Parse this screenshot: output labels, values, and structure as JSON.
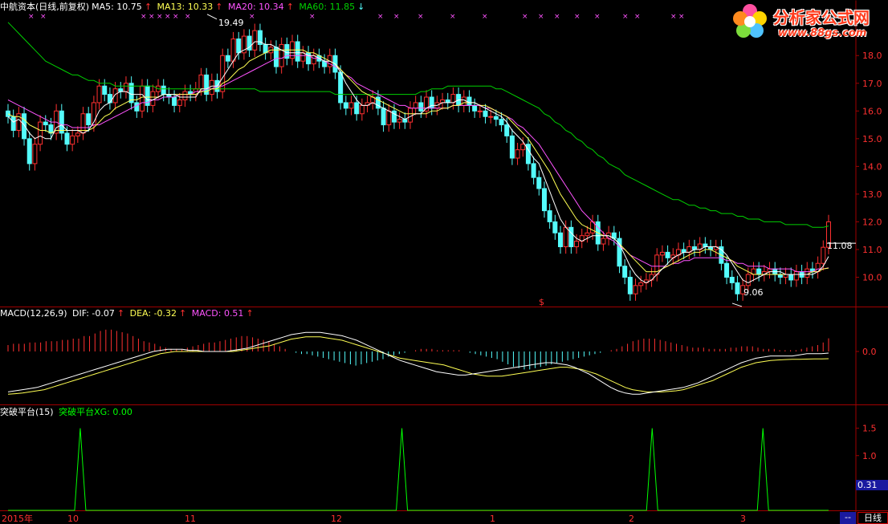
{
  "header": {
    "title": "中航资本(日线,前复权)",
    "ma5": "MA5: 10.75",
    "ma13": "MA13: 10.33",
    "ma20": "MA20: 10.34",
    "ma60": "MA60: 11.85",
    "up_arrow": "↑",
    "down_arrow": "↓"
  },
  "macd_header": {
    "title": "MACD(12,26,9)",
    "dif": "DIF: -0.07",
    "dea": "DEA: -0.32",
    "macd": "MACD: 0.51",
    "up_arrow": "↑"
  },
  "indicator_header": {
    "title": "突破平台(15)",
    "xg": "突破平台XG: 0.00"
  },
  "logo": {
    "name": "分析家公式网",
    "url": "www.88gs.com"
  },
  "annotations": {
    "high": "19.49",
    "low": "9.06",
    "last": "11.08",
    "signal_mark": "$"
  },
  "indicator_value": "0.31",
  "timeframe": "日线",
  "dash": "--",
  "x_axis_labels": [
    "2015年",
    "10",
    "11",
    "12",
    "1",
    "2",
    "3"
  ],
  "colors": {
    "up": "#ff3030",
    "down": "#54fcfc",
    "ma5": "#ffffff",
    "ma13": "#ffff54",
    "ma20": "#ff54ff",
    "ma60": "#00d000",
    "grid": "#a00000",
    "xg": "#00ff00"
  },
  "chart_data": [
    {
      "type": "candlestick",
      "title": "中航资本(日线,前复权)",
      "y_ticks": [
        10.0,
        11.0,
        12.0,
        13.0,
        14.0,
        15.0,
        16.0,
        17.0,
        18.0
      ],
      "ylim": [
        9.0,
        19.6
      ],
      "annotated_high": 19.49,
      "annotated_low": 9.06,
      "last_close": 11.08,
      "close": [
        15.8,
        15.3,
        15.9,
        15.0,
        14.1,
        14.8,
        15.6,
        15.5,
        15.2,
        16.0,
        15.2,
        14.8,
        15.1,
        15.2,
        15.9,
        15.5,
        16.3,
        16.9,
        16.6,
        16.3,
        16.8,
        16.7,
        17.0,
        16.3,
        16.0,
        16.9,
        16.2,
        16.7,
        16.9,
        16.6,
        16.5,
        16.2,
        16.4,
        16.7,
        16.6,
        16.8,
        17.3,
        16.6,
        17.1,
        16.7,
        18.0,
        17.8,
        18.6,
        18.1,
        18.7,
        18.2,
        18.9,
        18.4,
        18.1,
        18.3,
        17.6,
        18.4,
        17.9,
        18.5,
        17.8,
        18.1,
        17.7,
        18.0,
        17.8,
        17.6,
        18.0,
        17.4,
        16.3,
        16.1,
        16.3,
        15.9,
        16.2,
        16.3,
        16.5,
        16.1,
        15.5,
        16.0,
        15.6,
        15.7,
        15.6,
        16.1,
        16.3,
        16.0,
        16.5,
        16.1,
        16.3,
        16.4,
        16.3,
        16.6,
        16.2,
        16.5,
        16.2,
        16.0,
        16.0,
        15.8,
        15.8,
        15.7,
        15.5,
        15.1,
        14.3,
        14.6,
        14.8,
        14.1,
        13.6,
        13.2,
        12.4,
        12.0,
        11.6,
        11.1,
        11.8,
        11.1,
        11.3,
        11.5,
        11.6,
        12.0,
        11.2,
        11.4,
        11.6,
        11.4,
        10.4,
        10.0,
        9.4,
        9.7,
        9.8,
        9.9,
        10.1,
        10.8,
        10.9,
        10.7,
        10.8,
        11.0,
        10.9,
        11.1,
        11.0,
        11.2,
        11.1,
        11.0,
        11.1,
        10.5,
        10.0,
        9.8,
        9.4,
        9.7,
        10.1,
        10.3,
        10.1,
        10.2,
        10.3,
        10.1,
        10.0,
        10.1,
        9.9,
        10.2,
        10.0,
        10.3,
        10.2,
        10.5,
        11.08,
        12.0
      ],
      "ma5": [
        15.8,
        15.6,
        15.7,
        15.5,
        15.2,
        15.0,
        15.1,
        15.0,
        15.0,
        15.4,
        15.5,
        15.3,
        15.3,
        15.3,
        15.2,
        15.3,
        15.6,
        16.0,
        16.2,
        16.3,
        16.6,
        16.7,
        16.7,
        16.6,
        16.6,
        16.6,
        16.4,
        16.4,
        16.5,
        16.6,
        16.6,
        16.6,
        16.5,
        16.5,
        16.5,
        16.5,
        16.8,
        16.8,
        16.9,
        16.9,
        17.2,
        17.5,
        17.8,
        18.1,
        18.2,
        18.3,
        18.5,
        18.5,
        18.4,
        18.4,
        18.3,
        18.2,
        18.1,
        18.1,
        18.1,
        18.1,
        18.0,
        18.0,
        17.9,
        17.8,
        17.8,
        17.7,
        17.4,
        17.0,
        16.7,
        16.4,
        16.2,
        16.2,
        16.3,
        16.2,
        16.1,
        16.0,
        15.9,
        15.8,
        15.7,
        15.8,
        15.9,
        15.9,
        16.1,
        16.2,
        16.2,
        16.3,
        16.3,
        16.3,
        16.4,
        16.4,
        16.3,
        16.3,
        16.2,
        16.1,
        16.0,
        15.9,
        15.8,
        15.6,
        15.3,
        15.1,
        14.9,
        14.6,
        14.3,
        14.1,
        13.6,
        13.1,
        12.6,
        12.1,
        11.8,
        11.6,
        11.4,
        11.3,
        11.4,
        11.5,
        11.5,
        11.5,
        11.5,
        11.4,
        11.2,
        10.8,
        10.4,
        10.1,
        9.9,
        9.8,
        9.9,
        10.1,
        10.3,
        10.5,
        10.7,
        10.8,
        10.9,
        10.9,
        11.0,
        11.0,
        11.1,
        11.1,
        11.1,
        11.0,
        10.8,
        10.5,
        10.2,
        9.9,
        9.8,
        9.9,
        10.0,
        10.1,
        10.2,
        10.2,
        10.2,
        10.1,
        10.1,
        10.1,
        10.1,
        10.1,
        10.1,
        10.2,
        10.4,
        10.75
      ],
      "ma13": [
        15.9,
        15.8,
        15.8,
        15.7,
        15.5,
        15.4,
        15.3,
        15.3,
        15.2,
        15.3,
        15.3,
        15.3,
        15.3,
        15.3,
        15.3,
        15.3,
        15.4,
        15.6,
        15.8,
        15.9,
        16.1,
        16.2,
        16.3,
        16.4,
        16.4,
        16.5,
        16.5,
        16.5,
        16.5,
        16.6,
        16.6,
        16.6,
        16.6,
        16.6,
        16.6,
        16.6,
        16.7,
        16.7,
        16.8,
        16.8,
        17.0,
        17.1,
        17.3,
        17.5,
        17.6,
        17.8,
        17.9,
        18.0,
        18.1,
        18.2,
        18.2,
        18.2,
        18.2,
        18.2,
        18.2,
        18.2,
        18.1,
        18.1,
        18.0,
        17.9,
        17.8,
        17.7,
        17.5,
        17.3,
        17.1,
        16.9,
        16.7,
        16.6,
        16.5,
        16.4,
        16.3,
        16.2,
        16.1,
        16.0,
        15.9,
        15.9,
        15.9,
        15.9,
        15.9,
        16.0,
        16.0,
        16.1,
        16.1,
        16.2,
        16.2,
        16.3,
        16.3,
        16.3,
        16.2,
        16.2,
        16.1,
        16.0,
        15.9,
        15.8,
        15.6,
        15.4,
        15.2,
        15.0,
        14.7,
        14.4,
        14.1,
        13.8,
        13.4,
        13.0,
        12.7,
        12.4,
        12.1,
        11.9,
        11.8,
        11.7,
        11.6,
        11.5,
        11.5,
        11.4,
        11.2,
        11.0,
        10.8,
        10.6,
        10.4,
        10.2,
        10.2,
        10.2,
        10.3,
        10.4,
        10.5,
        10.6,
        10.7,
        10.8,
        10.9,
        10.9,
        11.0,
        11.0,
        10.9,
        10.8,
        10.7,
        10.6,
        10.4,
        10.3,
        10.2,
        10.1,
        10.1,
        10.1,
        10.1,
        10.1,
        10.1,
        10.1,
        10.1,
        10.1,
        10.1,
        10.1,
        10.2,
        10.2,
        10.3,
        10.33
      ],
      "ma20": [
        16.4,
        16.3,
        16.2,
        16.1,
        16.0,
        15.9,
        15.8,
        15.7,
        15.6,
        15.6,
        15.5,
        15.5,
        15.4,
        15.4,
        15.4,
        15.4,
        15.5,
        15.5,
        15.6,
        15.7,
        15.8,
        15.9,
        16.0,
        16.1,
        16.2,
        16.3,
        16.3,
        16.4,
        16.4,
        16.5,
        16.5,
        16.5,
        16.6,
        16.6,
        16.6,
        16.7,
        16.7,
        16.8,
        16.8,
        16.9,
        16.9,
        17.0,
        17.1,
        17.2,
        17.3,
        17.4,
        17.5,
        17.6,
        17.7,
        17.8,
        17.9,
        17.9,
        18.0,
        18.0,
        18.0,
        18.0,
        18.0,
        17.9,
        17.9,
        17.8,
        17.7,
        17.6,
        17.5,
        17.3,
        17.2,
        17.0,
        16.9,
        16.8,
        16.7,
        16.6,
        16.5,
        16.4,
        16.3,
        16.2,
        16.2,
        16.1,
        16.1,
        16.1,
        16.1,
        16.1,
        16.1,
        16.1,
        16.1,
        16.2,
        16.2,
        16.2,
        16.2,
        16.2,
        16.2,
        16.1,
        16.1,
        16.0,
        15.9,
        15.8,
        15.7,
        15.5,
        15.4,
        15.2,
        15.0,
        14.8,
        14.5,
        14.2,
        13.9,
        13.6,
        13.3,
        13.0,
        12.7,
        12.4,
        12.2,
        12.0,
        11.8,
        11.6,
        11.4,
        11.3,
        11.1,
        11.0,
        10.8,
        10.7,
        10.6,
        10.5,
        10.4,
        10.4,
        10.4,
        10.4,
        10.5,
        10.5,
        10.6,
        10.6,
        10.7,
        10.7,
        10.7,
        10.7,
        10.7,
        10.7,
        10.6,
        10.6,
        10.5,
        10.5,
        10.4,
        10.4,
        10.4,
        10.4,
        10.3,
        10.3,
        10.3,
        10.3,
        10.3,
        10.2,
        10.2,
        10.2,
        10.2,
        10.3,
        10.3,
        10.34
      ],
      "ma60": [
        19.2,
        19.0,
        18.8,
        18.6,
        18.4,
        18.2,
        18.0,
        17.8,
        17.7,
        17.6,
        17.5,
        17.4,
        17.3,
        17.3,
        17.2,
        17.1,
        17.1,
        17.0,
        17.0,
        17.0,
        16.9,
        16.9,
        16.9,
        16.9,
        16.9,
        16.9,
        16.9,
        16.9,
        16.8,
        16.8,
        16.8,
        16.8,
        16.8,
        16.8,
        16.8,
        16.8,
        16.8,
        16.8,
        16.8,
        16.8,
        16.8,
        16.8,
        16.8,
        16.8,
        16.8,
        16.8,
        16.8,
        16.7,
        16.7,
        16.7,
        16.7,
        16.7,
        16.7,
        16.7,
        16.7,
        16.7,
        16.7,
        16.7,
        16.7,
        16.7,
        16.7,
        16.6,
        16.6,
        16.6,
        16.6,
        16.6,
        16.6,
        16.6,
        16.6,
        16.6,
        16.6,
        16.6,
        16.6,
        16.6,
        16.6,
        16.6,
        16.6,
        16.7,
        16.7,
        16.8,
        16.8,
        16.8,
        16.9,
        16.9,
        16.9,
        16.9,
        16.9,
        16.9,
        16.9,
        16.9,
        16.9,
        16.8,
        16.8,
        16.7,
        16.6,
        16.5,
        16.4,
        16.3,
        16.2,
        16.1,
        15.9,
        15.8,
        15.6,
        15.5,
        15.3,
        15.2,
        15.0,
        14.9,
        14.7,
        14.6,
        14.4,
        14.3,
        14.1,
        14.0,
        13.9,
        13.7,
        13.6,
        13.5,
        13.4,
        13.3,
        13.2,
        13.1,
        13.0,
        12.9,
        12.8,
        12.8,
        12.7,
        12.6,
        12.6,
        12.5,
        12.5,
        12.4,
        12.4,
        12.3,
        12.3,
        12.3,
        12.2,
        12.2,
        12.1,
        12.1,
        12.1,
        12.0,
        12.0,
        12.0,
        12.0,
        11.9,
        11.9,
        11.9,
        11.9,
        11.9,
        11.8,
        11.8,
        11.8,
        11.85
      ]
    },
    {
      "type": "macd",
      "title": "MACD(12,26,9)",
      "y_ticks": [
        0.0
      ],
      "dif_last": -0.07,
      "dea_last": -0.32,
      "macd_last": 0.51,
      "macd": [
        0.25,
        0.3,
        0.3,
        0.3,
        0.35,
        0.35,
        0.35,
        0.4,
        0.4,
        0.4,
        0.45,
        0.45,
        0.5,
        0.5,
        0.6,
        0.6,
        0.7,
        0.8,
        0.85,
        0.85,
        0.8,
        0.75,
        0.7,
        0.6,
        0.5,
        0.4,
        0.35,
        0.3,
        0.2,
        0.15,
        0.1,
        0.1,
        0.1,
        0.15,
        0.2,
        0.25,
        0.3,
        0.35,
        0.35,
        0.4,
        0.45,
        0.5,
        0.55,
        0.6,
        0.6,
        0.55,
        0.5,
        0.45,
        0.4,
        0.3,
        0.2,
        0.1,
        0.0,
        -0.05,
        -0.1,
        -0.1,
        -0.15,
        -0.2,
        -0.25,
        -0.3,
        -0.35,
        -0.4,
        -0.45,
        -0.5,
        -0.55,
        -0.5,
        -0.45,
        -0.4,
        -0.35,
        -0.3,
        -0.2,
        -0.15,
        -0.1,
        -0.05,
        0.0,
        0.05,
        0.1,
        0.1,
        0.1,
        0.05,
        0.05,
        0.05,
        0.05,
        0.05,
        0.0,
        -0.05,
        -0.1,
        -0.15,
        -0.2,
        -0.25,
        -0.3,
        -0.4,
        -0.5,
        -0.6,
        -0.65,
        -0.7,
        -0.7,
        -0.65,
        -0.6,
        -0.55,
        -0.5,
        -0.45,
        -0.4,
        -0.35,
        -0.3,
        -0.25,
        -0.2,
        -0.15,
        -0.1,
        -0.05,
        0.0,
        0.05,
        0.1,
        0.2,
        0.3,
        0.4,
        0.45,
        0.5,
        0.5,
        0.5,
        0.45,
        0.4,
        0.35,
        0.3,
        0.25,
        0.2,
        0.15,
        0.15,
        0.15,
        0.1,
        0.1,
        0.1,
        0.1,
        0.15,
        0.15,
        0.2,
        0.2,
        0.2,
        0.15,
        0.1,
        0.1,
        0.1,
        0.05,
        0.05,
        0.05,
        0.05,
        0.1,
        0.15,
        0.2,
        0.25,
        0.35,
        0.51
      ],
      "dif": [
        -1.8,
        -1.75,
        -1.7,
        -1.65,
        -1.6,
        -1.5,
        -1.4,
        -1.3,
        -1.2,
        -1.1,
        -1.0,
        -0.9,
        -0.8,
        -0.7,
        -0.6,
        -0.5,
        -0.4,
        -0.3,
        -0.2,
        -0.1,
        0.0,
        0.05,
        0.1,
        0.1,
        0.1,
        0.05,
        0.05,
        0.0,
        0.0,
        0.0,
        0.0,
        0.05,
        0.1,
        0.15,
        0.25,
        0.35,
        0.45,
        0.55,
        0.65,
        0.75,
        0.8,
        0.85,
        0.85,
        0.85,
        0.8,
        0.75,
        0.7,
        0.6,
        0.5,
        0.35,
        0.2,
        0.05,
        -0.1,
        -0.25,
        -0.4,
        -0.5,
        -0.6,
        -0.7,
        -0.8,
        -0.9,
        -0.95,
        -1.0,
        -1.05,
        -1.05,
        -1.0,
        -0.95,
        -0.9,
        -0.85,
        -0.8,
        -0.75,
        -0.7,
        -0.65,
        -0.6,
        -0.55,
        -0.5,
        -0.5,
        -0.55,
        -0.6,
        -0.7,
        -0.85,
        -1.0,
        -1.2,
        -1.4,
        -1.6,
        -1.75,
        -1.85,
        -1.9,
        -1.9,
        -1.85,
        -1.8,
        -1.75,
        -1.7,
        -1.65,
        -1.6,
        -1.5,
        -1.4,
        -1.25,
        -1.1,
        -0.95,
        -0.8,
        -0.65,
        -0.5,
        -0.4,
        -0.3,
        -0.25,
        -0.2,
        -0.2,
        -0.2,
        -0.2,
        -0.15,
        -0.1,
        -0.1,
        -0.1,
        -0.07
      ],
      "dea": [
        -1.9,
        -1.88,
        -1.85,
        -1.8,
        -1.75,
        -1.7,
        -1.6,
        -1.5,
        -1.4,
        -1.3,
        -1.2,
        -1.1,
        -1.0,
        -0.9,
        -0.8,
        -0.7,
        -0.6,
        -0.5,
        -0.4,
        -0.3,
        -0.2,
        -0.1,
        -0.05,
        0.0,
        0.0,
        0.0,
        0.0,
        0.0,
        0.0,
        0.0,
        0.0,
        0.0,
        0.05,
        0.1,
        0.15,
        0.2,
        0.25,
        0.35,
        0.45,
        0.55,
        0.6,
        0.65,
        0.65,
        0.65,
        0.6,
        0.55,
        0.5,
        0.4,
        0.3,
        0.2,
        0.1,
        0.0,
        -0.1,
        -0.2,
        -0.3,
        -0.35,
        -0.4,
        -0.45,
        -0.5,
        -0.55,
        -0.6,
        -0.7,
        -0.8,
        -0.9,
        -1.0,
        -1.05,
        -1.1,
        -1.1,
        -1.1,
        -1.05,
        -1.0,
        -0.95,
        -0.9,
        -0.85,
        -0.8,
        -0.75,
        -0.7,
        -0.7,
        -0.75,
        -0.8,
        -0.9,
        -1.0,
        -1.15,
        -1.3,
        -1.45,
        -1.6,
        -1.7,
        -1.75,
        -1.8,
        -1.8,
        -1.8,
        -1.78,
        -1.75,
        -1.7,
        -1.6,
        -1.5,
        -1.4,
        -1.3,
        -1.15,
        -1.0,
        -0.85,
        -0.7,
        -0.6,
        -0.5,
        -0.45,
        -0.4,
        -0.38,
        -0.36,
        -0.35,
        -0.35,
        -0.34,
        -0.33,
        -0.33,
        -0.32
      ]
    },
    {
      "type": "line",
      "title": "突破平台(15)",
      "y_ticks": [
        0.5,
        1.0,
        1.5
      ],
      "ylim": [
        0.0,
        1.7
      ],
      "xg_last": 0.0,
      "spike_fractions": [
        0.088,
        0.48,
        0.785,
        0.92
      ],
      "spike_value": 1.5
    }
  ]
}
